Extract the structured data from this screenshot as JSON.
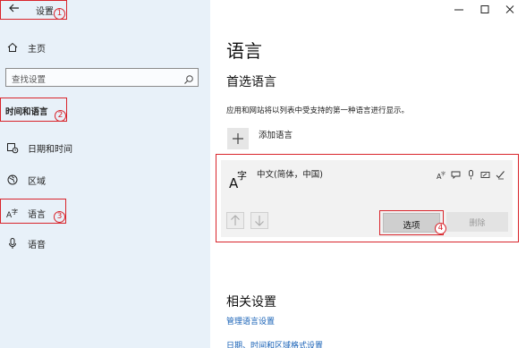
{
  "sidebar": {
    "back_icon": "back-arrow-icon",
    "title": "设置",
    "home": {
      "label": "主页",
      "icon": "home-icon"
    },
    "search": {
      "placeholder": "查找设置",
      "icon": "search-icon"
    },
    "section_title": "时间和语言",
    "items": [
      {
        "label": "日期和时间",
        "icon": "calendar-clock-icon"
      },
      {
        "label": "区域",
        "icon": "globe-icon"
      },
      {
        "label": "语言",
        "icon": "language-icon",
        "selected": true
      },
      {
        "label": "语音",
        "icon": "microphone-icon"
      }
    ]
  },
  "window_controls": {
    "minimize": "minimize-icon",
    "maximize": "maximize-icon",
    "close": "close-icon"
  },
  "main": {
    "title": "语言",
    "preferred_heading": "首选语言",
    "preferred_desc": "应用和网站将以列表中受支持的第一种语言进行显示。",
    "add_language_label": "添加语言",
    "language": {
      "name": "中文(简体，中国)",
      "glyph": "A字",
      "feature_icons": [
        "display-language-icon",
        "speech-icon",
        "microphone-icon",
        "handwriting-icon",
        "spellcheck-icon"
      ]
    },
    "options_label": "选项",
    "remove_label": "删除",
    "related_heading": "相关设置",
    "link_manage": "管理语言设置",
    "link_datetime": "日期、时间和区域格式设置"
  },
  "annotations": {
    "n1": "1",
    "n2": "2",
    "n3": "3",
    "n4": "4"
  },
  "colors": {
    "sidebar_bg": "#e8f1f9",
    "annotation": "#d9242b",
    "link": "#1660b6"
  }
}
